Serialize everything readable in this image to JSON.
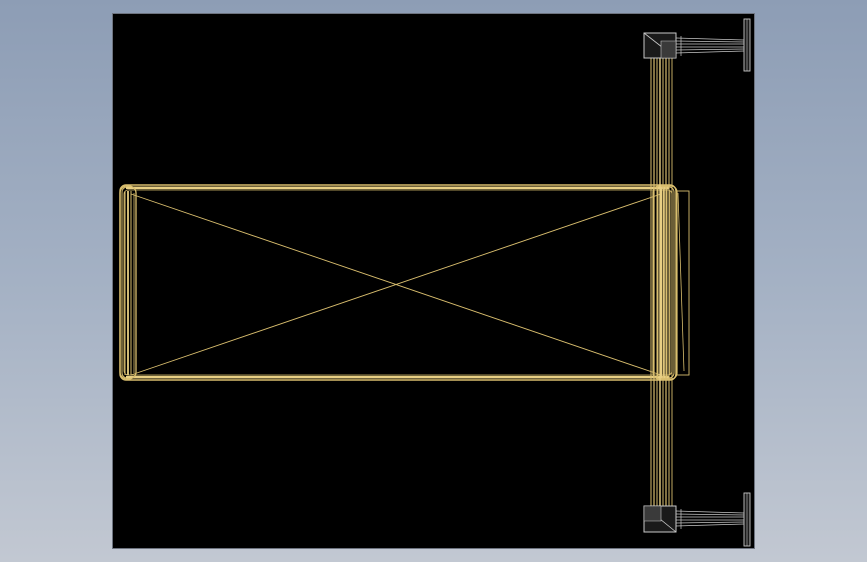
{
  "viewport": {
    "background": "#000000",
    "frame_color": "#6e7480"
  },
  "drawing": {
    "line_color": "#d9be6e",
    "line_color_bright": "#e8cf84",
    "hardware_color": "#c8c8c8",
    "hardware_dark": "#3a3a3a",
    "hardware_fill": "#1a1a1a"
  }
}
